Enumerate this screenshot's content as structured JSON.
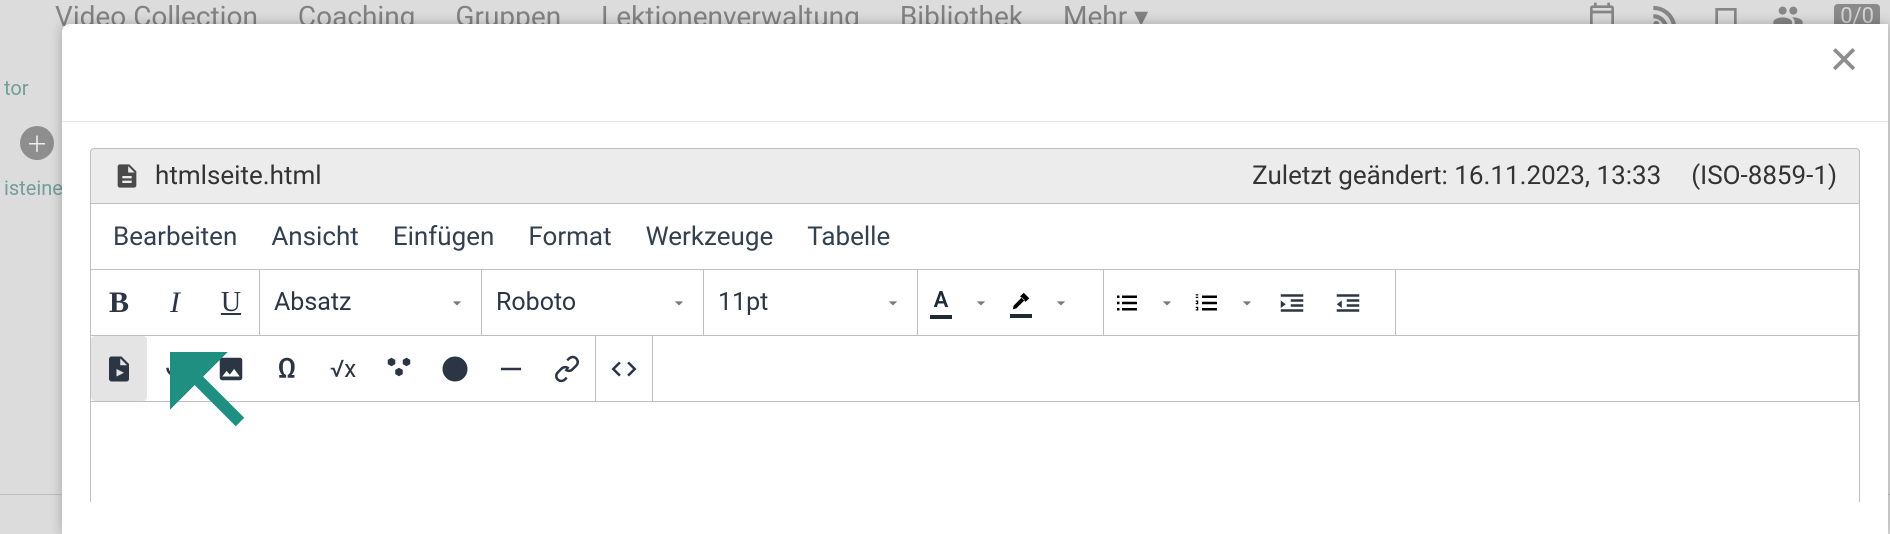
{
  "bg": {
    "nav": [
      "Video Collection",
      "Coaching",
      "Gruppen",
      "Lektionenverwaltung",
      "Bibliothek",
      "Mehr ▾"
    ],
    "sidebar": {
      "item1": "tor",
      "item2": "isteine"
    },
    "counter": "0/0"
  },
  "modal": {
    "file": {
      "name": "htmlseite.html",
      "modified_label": "Zuletzt geändert: 16.11.2023, 13:33",
      "encoding": "(ISO-8859-1)"
    },
    "menu": {
      "edit": "Bearbeiten",
      "view": "Ansicht",
      "insert": "Einfügen",
      "format": "Format",
      "tools": "Werkzeuge",
      "table": "Tabelle"
    },
    "toolbar": {
      "bold": "B",
      "italic": "I",
      "underline": "U",
      "block_format": "Absatz",
      "font_family": "Roboto",
      "font_size": "11pt"
    }
  }
}
